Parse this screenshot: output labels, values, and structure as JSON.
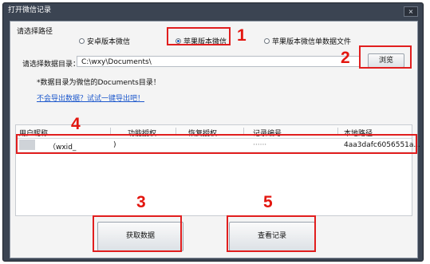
{
  "window": {
    "title": "打开微信记录",
    "close_icon": "×"
  },
  "path_group": {
    "label": "请选择路径",
    "options": [
      {
        "label": "安卓版本微信",
        "selected": false
      },
      {
        "label": "苹果版本微信",
        "selected": true
      },
      {
        "label": "苹果版本微信单数据文件",
        "selected": false
      }
    ]
  },
  "directory": {
    "label": "请选择数据目录：",
    "value": "C:\\wxy\\Documents\\",
    "browse_label": "浏览"
  },
  "note": "*数据目录为微信的Documents目录！",
  "help_link": "不会导出数据？试试一键导出吧！",
  "table": {
    "columns": [
      "用户昵称",
      "功能授权",
      "恢复授权",
      "记录编号",
      "本地路径"
    ],
    "rows": [
      {
        "nickname": "（wxid_",
        "func_auth": ")",
        "restore_auth": "",
        "record_id": "······",
        "local_path": "4aa3dafc6056551a..."
      }
    ]
  },
  "actions": {
    "fetch_label": "获取数据",
    "view_label": "查看记录"
  },
  "annotations": [
    "1",
    "2",
    "3",
    "4",
    "5"
  ],
  "colors": {
    "annotation": "#e11e1e",
    "titlebar": "#3b4452",
    "link": "#1d58cc"
  }
}
